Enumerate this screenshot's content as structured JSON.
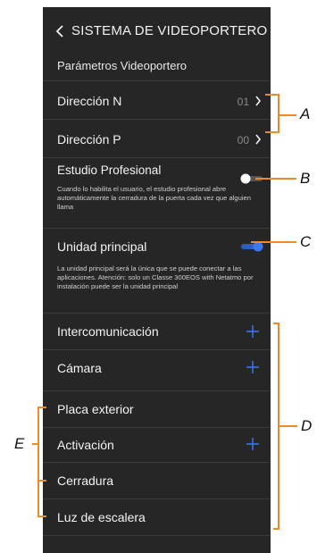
{
  "header": {
    "title": "SISTEMA DE VIDEOPORTERO",
    "back_icon": "chevron-left-icon"
  },
  "subtitle": "Parámetros Videoportero",
  "address_rows": [
    {
      "label": "Dirección N",
      "value": "01"
    },
    {
      "label": "Dirección P",
      "value": "00"
    }
  ],
  "studio": {
    "label": "Estudio Profesional",
    "description": "Cuando lo habilita el usuario, el estudio profesional abre automáticamente la cerradura de la puerta cada vez que alguien llama",
    "enabled": false
  },
  "main_unit": {
    "label": "Unidad principal",
    "description": "La unidad principal será la única que se puede conectar a las aplicaciones. Atención: solo un Classe 300EOS with Netatmo por instalación puede ser la unidad principal",
    "enabled": true
  },
  "list_items": [
    {
      "label": "Intercomunicación",
      "has_add": true
    },
    {
      "label": "Cámara",
      "has_add": true
    },
    {
      "label": "Placa exterior",
      "has_add": false
    },
    {
      "label": "Activación",
      "has_add": true
    },
    {
      "label": "Cerradura",
      "has_add": false
    },
    {
      "label": "Luz de escalera",
      "has_add": false
    }
  ],
  "annotations": {
    "a": "A",
    "b": "B",
    "c": "C",
    "d": "D",
    "e": "E"
  },
  "colors": {
    "background": "#262626",
    "accent": "#3b78f0",
    "callout": "#ec8a2c",
    "divider": "#3c3c3c"
  }
}
